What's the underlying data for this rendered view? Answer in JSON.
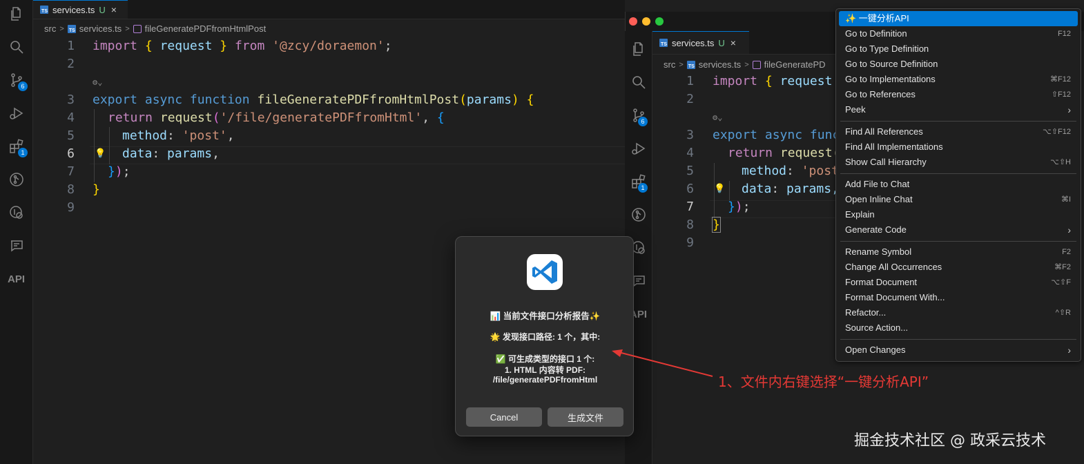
{
  "editor": {
    "tab": {
      "filename": "services.ts",
      "status": "U",
      "close_glyph": "×"
    },
    "breadcrumb": {
      "folder": "src",
      "file": "services.ts",
      "symbol": "fileGeneratePDFfromHtmlPost",
      "symbol_truncated": "fileGeneratePD"
    },
    "activity_badges": {
      "source_control": "6",
      "extensions": "1"
    },
    "activity_api_label": "API",
    "line_numbers": [
      "1",
      "2",
      "3",
      "4",
      "5",
      "6",
      "7",
      "8",
      "9"
    ],
    "code": {
      "l1": {
        "import": "import",
        "lb": "{",
        "request": "request",
        "rb": "}",
        "from": "from",
        "module": "'@zcy/doraemon'",
        "semi": ";"
      },
      "l3": {
        "export": "export",
        "async": "async",
        "function": "function",
        "name": "fileGeneratePDFfromHtmlPost",
        "lp": "(",
        "param": "params",
        "rp": ")",
        "lb": "{"
      },
      "l4": {
        "return": "return",
        "request": "request",
        "lp": "(",
        "url": "'/file/generatePDFfromHtml'",
        "comma": ",",
        "lb": "{"
      },
      "l5": {
        "key": "method",
        "colon": ":",
        "value": "'post'",
        "comma": ","
      },
      "l6": {
        "key": "data",
        "colon": ":",
        "value": "params",
        "comma": ","
      },
      "l7": {
        "rb": "}",
        "rp": ")",
        "semi": ";"
      },
      "l8": {
        "rb": "}"
      },
      "right_l4_return": "return",
      "right_l4_request": "request(",
      "right_l5_value": "'post",
      "right_l6_value": "params,",
      "right_l3_func": "func"
    }
  },
  "context_menu": {
    "items": [
      {
        "label": "✨ 一键分析API",
        "shortcut": ""
      },
      {
        "label": "Go to Definition",
        "shortcut": "F12"
      },
      {
        "label": "Go to Type Definition",
        "shortcut": ""
      },
      {
        "label": "Go to Source Definition",
        "shortcut": ""
      },
      {
        "label": "Go to Implementations",
        "shortcut": "⌘F12"
      },
      {
        "label": "Go to References",
        "shortcut": "⇧F12"
      },
      {
        "label": "Peek",
        "shortcut": ""
      },
      {
        "label": "Find All References",
        "shortcut": "⌥⇧F12"
      },
      {
        "label": "Find All Implementations",
        "shortcut": ""
      },
      {
        "label": "Show Call Hierarchy",
        "shortcut": "⌥⇧H"
      },
      {
        "label": "Add File to Chat",
        "shortcut": ""
      },
      {
        "label": "Open Inline Chat",
        "shortcut": "⌘I"
      },
      {
        "label": "Explain",
        "shortcut": ""
      },
      {
        "label": "Generate Code",
        "shortcut": ""
      },
      {
        "label": "Rename Symbol",
        "shortcut": "F2"
      },
      {
        "label": "Change All Occurrences",
        "shortcut": "⌘F2"
      },
      {
        "label": "Format Document",
        "shortcut": "⌥⇧F"
      },
      {
        "label": "Format Document With...",
        "shortcut": ""
      },
      {
        "label": "Refactor...",
        "shortcut": "^⇧R"
      },
      {
        "label": "Source Action...",
        "shortcut": ""
      },
      {
        "label": "Open Changes",
        "shortcut": ""
      }
    ],
    "submenu_glyph": "›"
  },
  "dialog": {
    "title": "📊 当前文件接口分析报告✨",
    "found": "🌟 发现接口路径: 1 个，其中:",
    "typed": "✅ 可生成类型的接口 1 个:",
    "item": "1. HTML 内容转 PDF:",
    "path": "/file/generatePDFfromHtml",
    "cancel": "Cancel",
    "confirm": "生成文件"
  },
  "annotation": "1、文件内右键选择“一键分析API”",
  "watermark": "掘金技术社区 @ 政采云技术",
  "colors": {
    "accent": "#0078d4",
    "arrow": "#e53935",
    "badge": "#0078d4"
  }
}
